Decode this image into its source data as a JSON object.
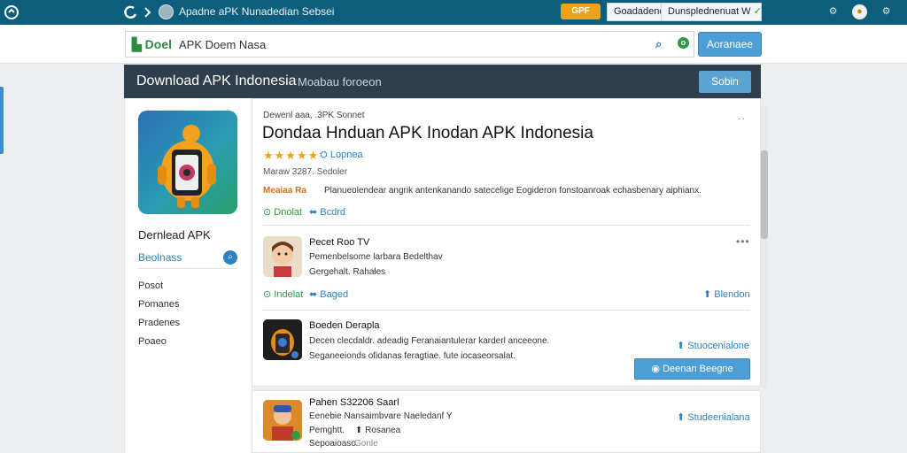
{
  "topbar": {
    "title": "Apadne aPK Nunadedian Sebsei",
    "badge": "GPF",
    "btn1": "Goadadene",
    "btn2": "Dunsplednenuat W"
  },
  "search": {
    "brand": "Doel",
    "value": "APK Doem Nasa",
    "submit": "Aoranaee"
  },
  "header": {
    "title": "Download APK Indonesia",
    "subtitle": "Moabau foroeon",
    "button": "Sobin"
  },
  "sidebar": {
    "title": "Dernlead APK",
    "active": "Beolnass",
    "items": [
      "Posot",
      "Pomanes",
      "Pradenes",
      "Poaeo"
    ]
  },
  "main": {
    "crumb": "Dewenl aaa, .3PK Sonnet",
    "title": "Dondaa Hnduan APK Inodan APK Indonesia",
    "stars": "★★★★★",
    "rating_link": "Lopnea",
    "meta": "Maraw 3287. Sedoler",
    "desc_tag": "Meaiaa Ra",
    "desc": "Planueolendear angrik antenkanando satecelige Eogideron fonstoanroak echasbenary aiphianx.",
    "action_left": "Dnolat",
    "action_right": "Bcdrd"
  },
  "list": [
    {
      "title": "Pecet Roo TV",
      "line1": "Pemenbelsome larbara Bedelthav",
      "link": "Gergehalt. Rahales",
      "act_left": "Indelat",
      "act_mid": "Baged",
      "act_right": "Blendon"
    },
    {
      "title": "Boeden Derapla",
      "line1": "Decen clecdaldr. adeadig Feranaiantulerar karderl anceeone.",
      "line2": "Seganeeionds ofidanas feragtiae. fute iocaseorsalat.",
      "act_right": "Stuocenialone",
      "button": "Deenan Beegne"
    },
    {
      "title": "Pahen S32206 Saarl",
      "line1": "Eenebie Nansaimbvare Naeledanf Y",
      "link_a": "Pemghtt.",
      "link_b": "Rosanea",
      "line3": "Sepoaioaso",
      "line3b": "Gonle",
      "act_right": "Studeenialana"
    }
  ]
}
